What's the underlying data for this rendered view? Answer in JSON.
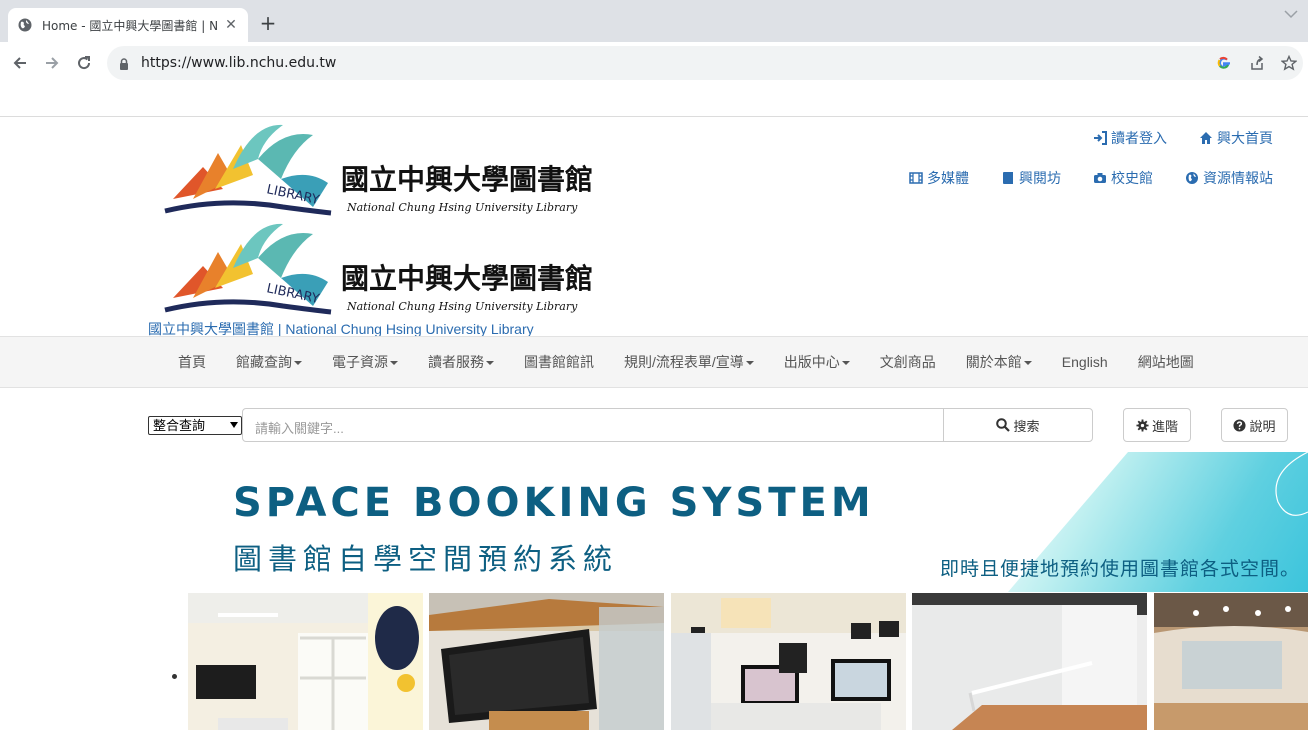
{
  "browser": {
    "tab_title": "Home - 國立中興大學圖書館 | N",
    "url": "https://www.lib.nchu.edu.tw"
  },
  "header": {
    "logo_cn": "國立中興大學圖書館",
    "logo_en": "National Chung Hsing University Library",
    "logo_badge": "LIBRARY",
    "caption": "國立中興大學圖書館 | National Chung Hsing University Library",
    "top_links": [
      "讀者登入",
      "興大首頁"
    ],
    "quick_links": [
      "多媒體",
      "興閱坊",
      "校史館",
      "資源情報站"
    ]
  },
  "nav": {
    "items": [
      {
        "label": "首頁",
        "dropdown": false
      },
      {
        "label": "館藏查詢",
        "dropdown": true
      },
      {
        "label": "電子資源",
        "dropdown": true
      },
      {
        "label": "讀者服務",
        "dropdown": true
      },
      {
        "label": "圖書館館訊",
        "dropdown": false
      },
      {
        "label": "規則/流程表單/宣導",
        "dropdown": true
      },
      {
        "label": "出版中心",
        "dropdown": true
      },
      {
        "label": "文創商品",
        "dropdown": false
      },
      {
        "label": "關於本館",
        "dropdown": true
      },
      {
        "label": "English",
        "dropdown": false
      },
      {
        "label": "網站地圖",
        "dropdown": false
      }
    ]
  },
  "search": {
    "scope": "整合查詢",
    "placeholder": "請輸入關鍵字...",
    "search_label": "搜索",
    "advanced_label": "進階",
    "help_label": "說明"
  },
  "banner": {
    "title_en": "SPACE BOOKING SYSTEM",
    "title_cn": "圖書館自學空間預約系統",
    "subtitle": "即時且便捷地預約使用圖書館各式空間。"
  },
  "colors": {
    "link_blue": "#2b6cb0",
    "banner_blue": "#0d5f82",
    "nav_bg": "#f5f5f5"
  }
}
